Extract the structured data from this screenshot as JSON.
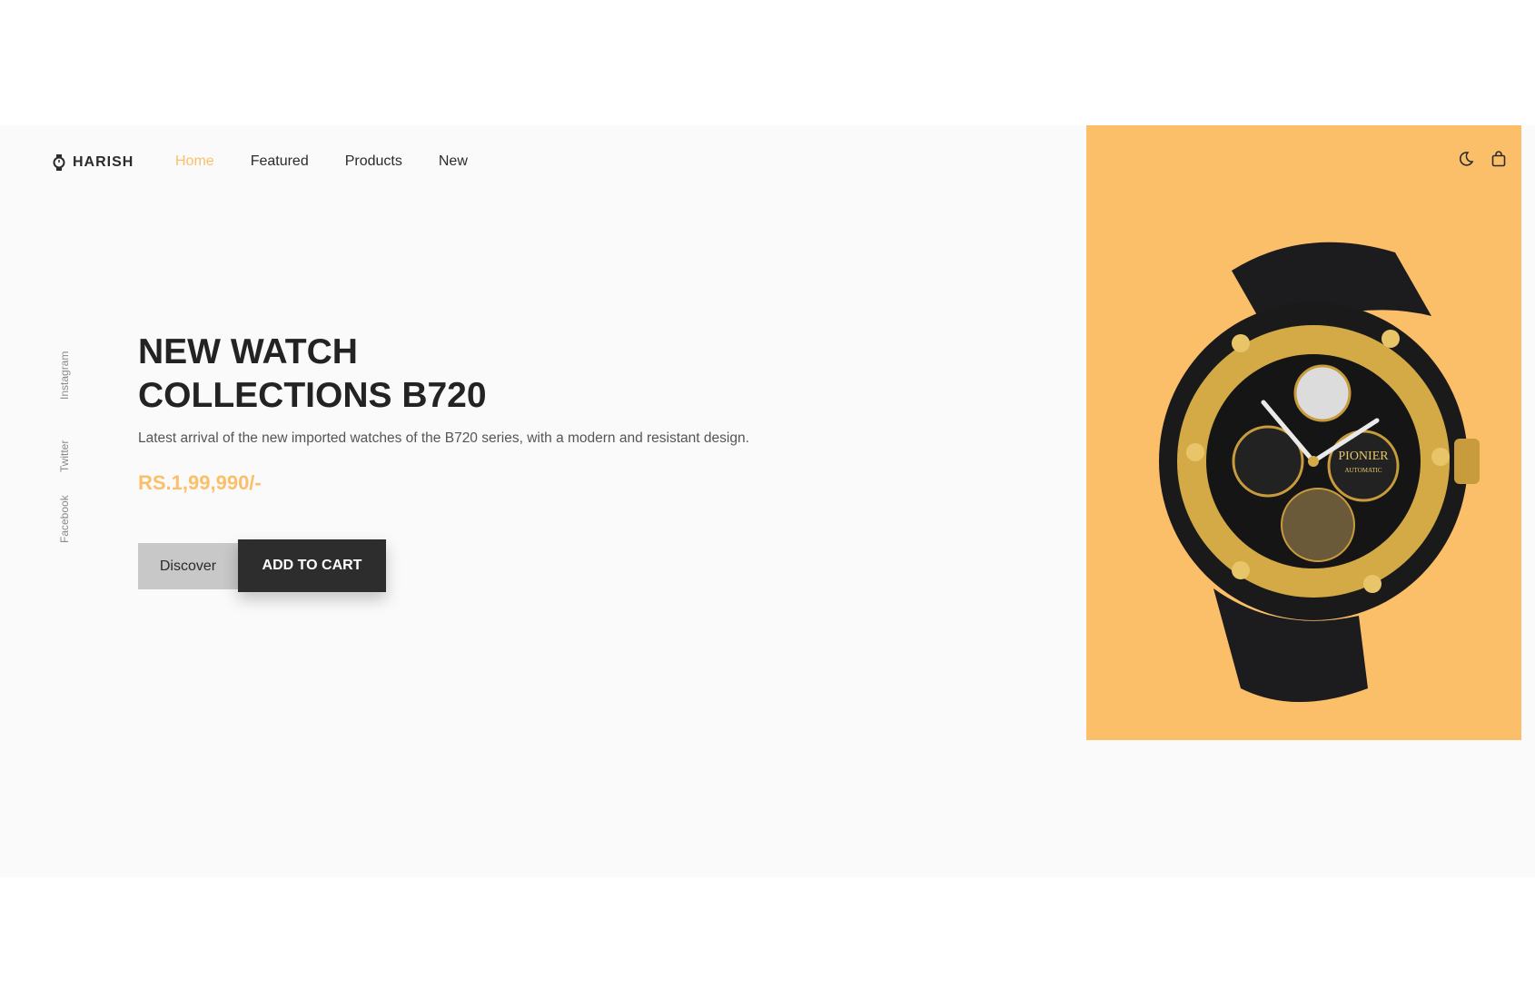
{
  "brand": {
    "name": "HARISH",
    "icon": "watch-icon"
  },
  "nav": {
    "items": [
      {
        "label": "Home",
        "active": true
      },
      {
        "label": "Featured",
        "active": false
      },
      {
        "label": "Products",
        "active": false
      },
      {
        "label": "New",
        "active": false
      }
    ]
  },
  "header_icons": [
    "moon-icon",
    "shopping-bag-icon"
  ],
  "social": {
    "links": [
      {
        "label": "Instagram"
      },
      {
        "label": "Twitter"
      },
      {
        "label": "Facebook"
      }
    ]
  },
  "hero": {
    "title_line1": "NEW WATCH",
    "title_line2": "COLLECTIONS B720",
    "description": "Latest arrival of the new imported watches of the B720 series, with a modern and resistant design.",
    "price": "RS.1,99,990/-",
    "discover_label": "Discover",
    "cart_label": "ADD TO CART"
  },
  "watch": {
    "brand_text": "PIONIER",
    "sub_text": "AUTOMATIC"
  },
  "colors": {
    "accent": "#fcbf69",
    "dark": "#2d2d2d",
    "background": "#fafafa"
  }
}
